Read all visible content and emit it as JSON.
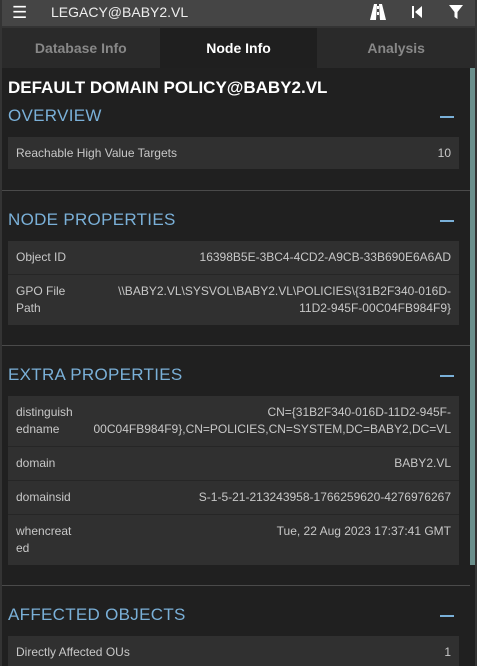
{
  "header": {
    "search_value": "LEGACY@BABY2.VL"
  },
  "tabs": [
    "Database Info",
    "Node Info",
    "Analysis"
  ],
  "node_title": "DEFAULT DOMAIN POLICY@BABY2.VL",
  "sections": {
    "overview": {
      "title": "OVERVIEW",
      "rows": [
        {
          "label": "Reachable High Value Targets",
          "value": "10"
        }
      ]
    },
    "node_properties": {
      "title": "NODE PROPERTIES",
      "rows": [
        {
          "label": "Object ID",
          "value": "16398B5E-3BC4-4CD2-A9CB-33B690E6A6AD"
        },
        {
          "label_l1": "GPO File",
          "label_l2": "Path",
          "value_l1": "\\\\BABY2.VL\\SYSVOL\\BABY2.VL\\POLICIES\\{31B2F340-016D-",
          "value_l2": "11D2-945F-00C04FB984F9}"
        }
      ]
    },
    "extra_properties": {
      "title": "EXTRA PROPERTIES",
      "rows": [
        {
          "label_l1": "distinguish",
          "label_l2": "edname",
          "value_l1": "CN={31B2F340-016D-11D2-945F-",
          "value_l2": "00C04FB984F9},CN=POLICIES,CN=SYSTEM,DC=BABY2,DC=VL"
        },
        {
          "label": "domain",
          "value": "BABY2.VL"
        },
        {
          "label": "domainsid",
          "value": "S-1-5-21-213243958-1766259620-4276976267"
        },
        {
          "label_l1": "whencreat",
          "label_l2": "ed",
          "value": "Tue, 22 Aug 2023 17:37:41 GMT"
        }
      ]
    },
    "affected_objects": {
      "title": "AFFECTED OBJECTS",
      "rows": [
        {
          "label": "Directly Affected OUs",
          "value": "1"
        }
      ]
    }
  },
  "colors": {
    "accent": "#7ab0d8",
    "panel_bg": "#202020",
    "row_bg": "#303030"
  },
  "icons": [
    "menu-icon",
    "pathfinding-icon",
    "back-icon",
    "filter-icon",
    "collapse-icon"
  ]
}
